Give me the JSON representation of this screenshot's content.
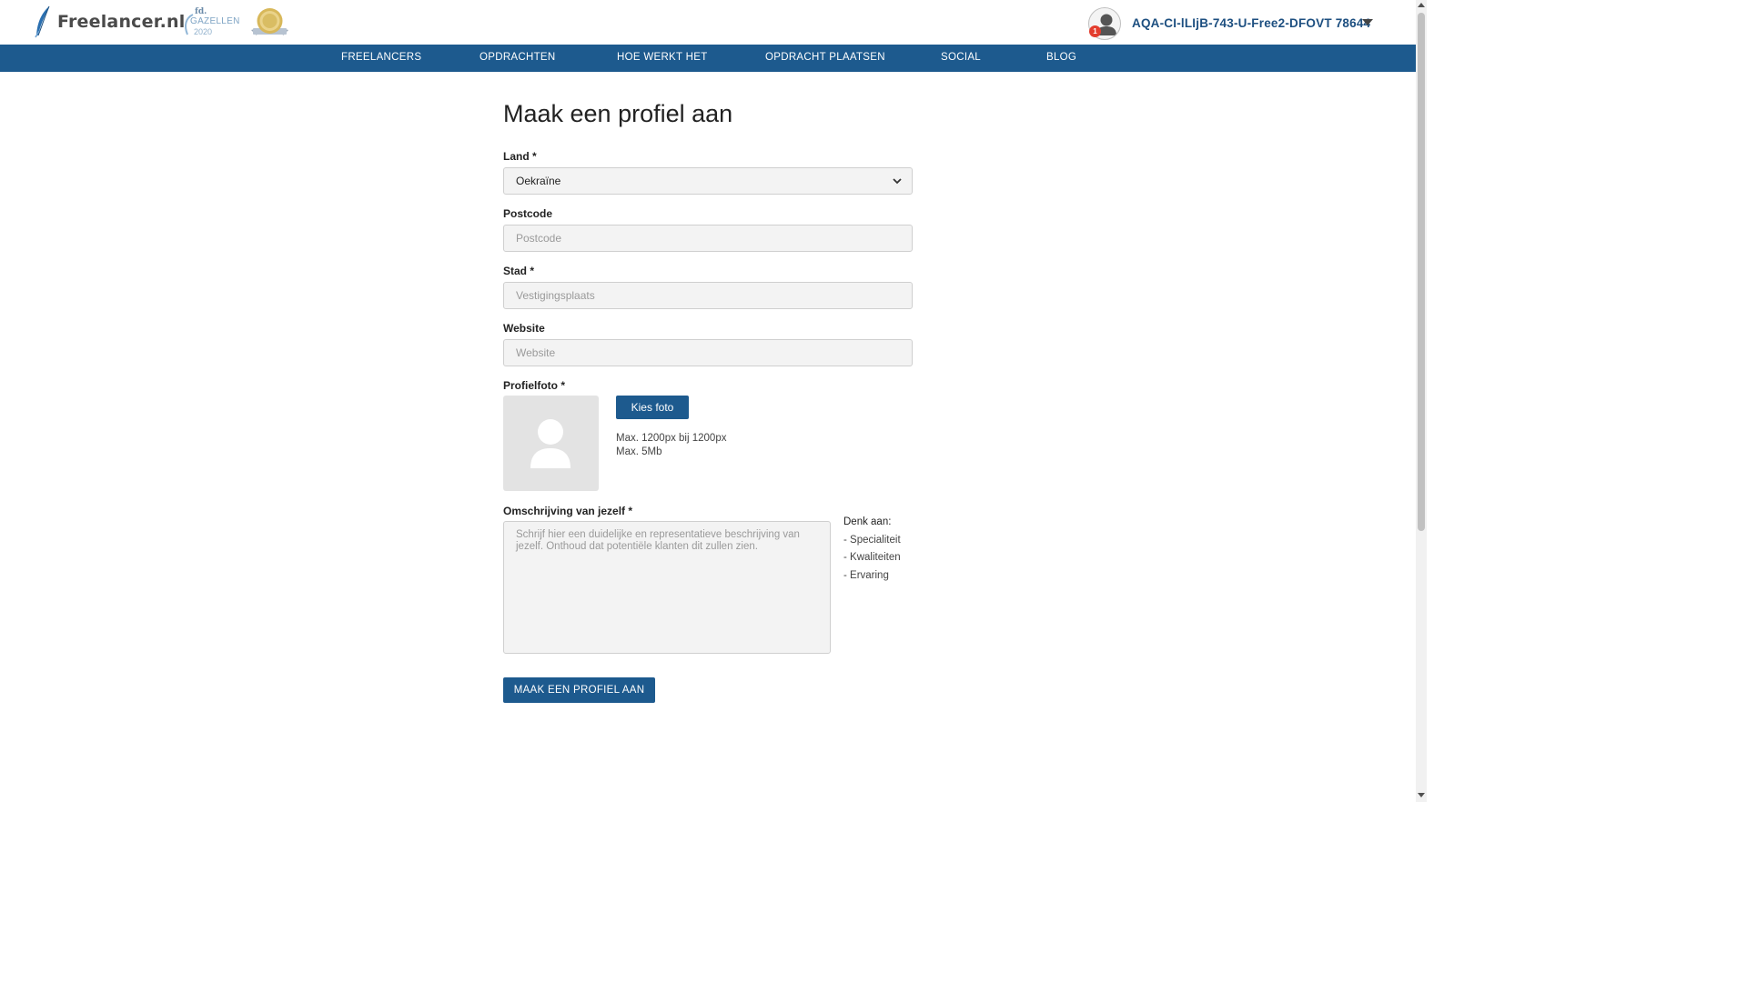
{
  "header": {
    "logo_text": "Freelancer.nl",
    "logo_icon": "feather-icon",
    "badge_gazellen": {
      "brand": "fd.",
      "word": "GAZELLEN",
      "year": "2020",
      "icon": "fd-gazellen-award-badge"
    },
    "badge_award": {
      "icon": "gold-award-seal-icon"
    },
    "user": {
      "name": "AQA-CI-lLIjB-743-U-Free2-DFOVT 78644",
      "notification_count": "1",
      "avatar_icon": "user-avatar-icon",
      "dropdown_icon": "caret-down-icon"
    }
  },
  "nav": {
    "items": [
      {
        "label": "FREELANCERS"
      },
      {
        "label": "OPDRACHTEN"
      },
      {
        "label": "HOE WERKT HET"
      },
      {
        "label": "OPDRACHT PLAATSEN"
      },
      {
        "label": "SOCIAL"
      },
      {
        "label": "BLOG"
      }
    ]
  },
  "form": {
    "title": "Maak een profiel aan",
    "land": {
      "label": "Land *",
      "value": "Oekraïne"
    },
    "postcode": {
      "label": "Postcode",
      "placeholder": "Postcode",
      "value": ""
    },
    "stad": {
      "label": "Stad *",
      "placeholder": "Vestigingsplaats",
      "value": ""
    },
    "website": {
      "label": "Website",
      "placeholder": "Website",
      "value": ""
    },
    "profielfoto": {
      "label": "Profielfoto *",
      "button": "Kies foto",
      "info_size": "Max. 1200px bij 1200px",
      "info_weight": "Max. 5Mb",
      "placeholder_icon": "user-silhouette-icon"
    },
    "omschrijving": {
      "label": "Omschrijving van jezelf *",
      "placeholder": "Schrijf hier een duidelijke en representatieve beschrijving van jezelf. Onthoud dat potentiële klanten dit zullen zien.",
      "value": ""
    },
    "hints": {
      "head": "Denk aan:",
      "items": [
        "- Specialiteit",
        "- Kwaliteiten",
        "- Ervaring"
      ]
    },
    "submit": "MAAK EEN PROFIEL AAN"
  },
  "colors": {
    "brand_blue": "#1d5a8e",
    "username_blue": "#1d4f80",
    "notification_red": "#e33d2e",
    "field_bg": "#f3f3f3"
  }
}
